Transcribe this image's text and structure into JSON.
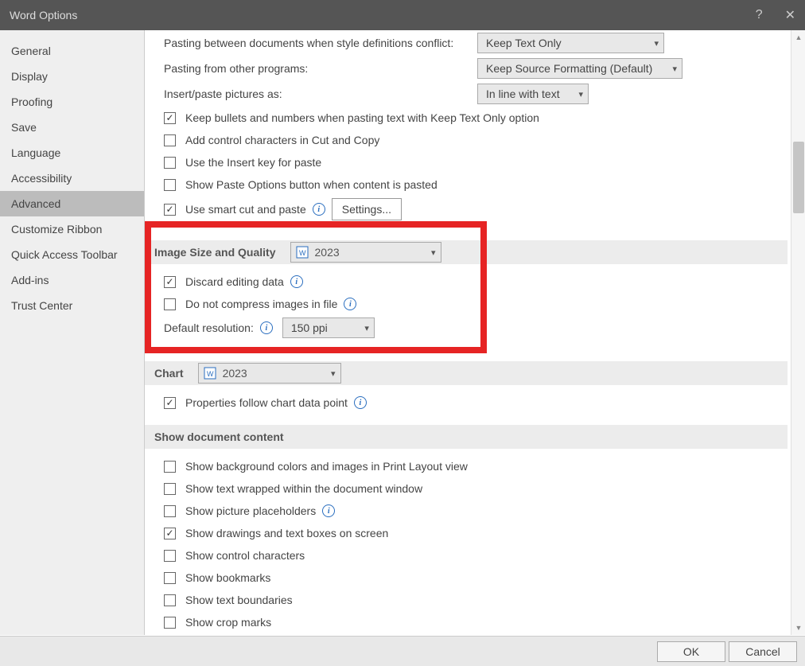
{
  "title": "Word Options",
  "sidebar": {
    "items": [
      {
        "label": "General"
      },
      {
        "label": "Display"
      },
      {
        "label": "Proofing"
      },
      {
        "label": "Save"
      },
      {
        "label": "Language"
      },
      {
        "label": "Accessibility"
      },
      {
        "label": "Advanced",
        "active": true
      },
      {
        "label": "Customize Ribbon"
      },
      {
        "label": "Quick Access Toolbar"
      },
      {
        "label": "Add-ins"
      },
      {
        "label": "Trust Center"
      }
    ]
  },
  "main": {
    "pasting_between_label": "Pasting between documents when style definitions conflict:",
    "pasting_between_value": "Keep Text Only",
    "pasting_from_label": "Pasting from other programs:",
    "pasting_from_value": "Keep Source Formatting (Default)",
    "insert_paste_label": "Insert/paste pictures as:",
    "insert_paste_value": "In line with text",
    "cb_keep_bullets": {
      "label": "Keep bullets and numbers when pasting text with Keep Text Only option",
      "checked": true
    },
    "cb_add_control": {
      "label": "Add control characters in Cut and Copy",
      "checked": false
    },
    "cb_use_insert": {
      "label": "Use the Insert key for paste",
      "checked": false
    },
    "cb_show_paste": {
      "label": "Show Paste Options button when content is pasted",
      "checked": false
    },
    "cb_smart_cut": {
      "label": "Use smart cut and paste",
      "checked": true
    },
    "settings_btn": "Settings...",
    "image_section_title": "Image Size and Quality",
    "image_section_doc": "2023",
    "cb_discard": {
      "label": "Discard editing data",
      "checked": true
    },
    "cb_no_compress": {
      "label": "Do not compress images in file",
      "checked": false
    },
    "default_res_label": "Default resolution:",
    "default_res_value": "150 ppi",
    "chart_section_title": "Chart",
    "chart_section_doc": "2023",
    "cb_prop_follow": {
      "label": "Properties follow chart data point",
      "checked": true
    },
    "show_doc_title": "Show document content",
    "cb_bg_colors": {
      "label": "Show background colors and images in Print Layout view",
      "checked": false
    },
    "cb_text_wrap": {
      "label": "Show text wrapped within the document window",
      "checked": false
    },
    "cb_pic_place": {
      "label": "Show picture placeholders",
      "checked": false
    },
    "cb_drawings": {
      "label": "Show drawings and text boxes on screen",
      "checked": true
    },
    "cb_ctrl_chars": {
      "label": "Show control characters",
      "checked": false
    },
    "cb_bookmarks": {
      "label": "Show bookmarks",
      "checked": false
    },
    "cb_text_bounds": {
      "label": "Show text boundaries",
      "checked": false
    },
    "cb_crop_marks": {
      "label": "Show crop marks",
      "checked": false
    }
  },
  "footer": {
    "ok": "OK",
    "cancel": "Cancel"
  }
}
